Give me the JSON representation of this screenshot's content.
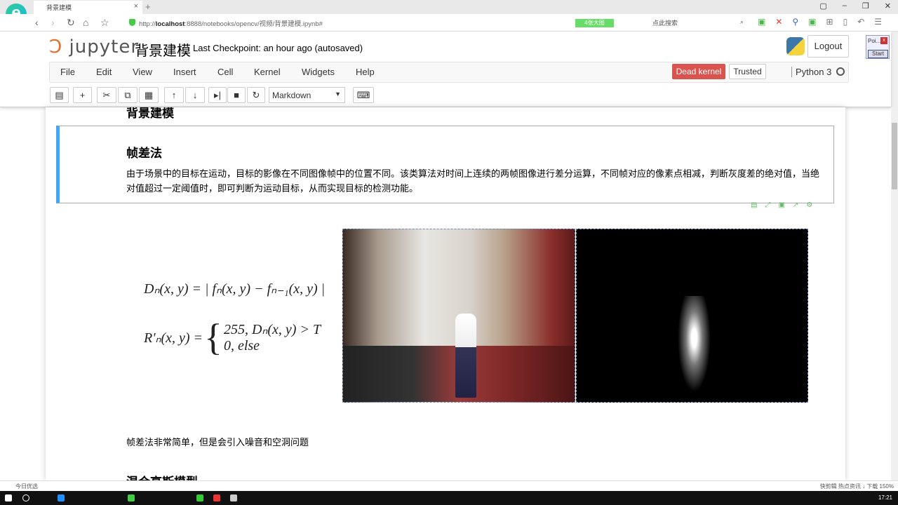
{
  "browser": {
    "tab_title": "背景建模",
    "url_host": "localhost",
    "url_prefix": "http://",
    "url_rest": ":8888/notebooks/opencv/视频/背景建模.ipynb#",
    "badge": "4张大图",
    "search_placeholder": "点此搜索",
    "win_controls": [
      "▢",
      "–",
      "❐",
      "✕"
    ]
  },
  "jupyter": {
    "logo": "jupyter",
    "notebook_title": "背景建模",
    "checkpoint": "Last Checkpoint: an hour ago (autosaved)",
    "logout": "Logout",
    "popup_title": "Poi...",
    "popup_close": "x",
    "popup_start": "Start",
    "menu": [
      "File",
      "Edit",
      "View",
      "Insert",
      "Cell",
      "Kernel",
      "Widgets",
      "Help"
    ],
    "dead_kernel": "Dead kernel",
    "trusted": "Trusted",
    "kernel_name": "Python 3",
    "cell_type": "Markdown"
  },
  "notebook": {
    "h1": "背景建模",
    "h2": "帧差法",
    "paragraph": "由于场景中的目标在运动，目标的影像在不同图像帧中的位置不同。该类算法对时间上连续的两帧图像进行差分运算，不同帧对应的像素点相减，判断灰度差的绝对值，当绝对值超过一定阈值时，即可判断为运动目标，从而实现目标的检测功能。",
    "formula1": "Dₙ(x, y) = | fₙ(x, y) − fₙ₋₁(x, y) |",
    "formula2_lhs": "R'ₙ(x, y) =",
    "formula2_case1": "255, Dₙ(x, y) > T",
    "formula2_case2": "0, else",
    "note": "帧差法非常简单，但是会引入噪音和空洞问题",
    "h2_next": "混合高斯模型"
  },
  "status": {
    "left": "今日优选",
    "right": "快剪辑   热点资讯   ↓ 下载   150%"
  },
  "taskbar": {
    "time": "17:21"
  }
}
